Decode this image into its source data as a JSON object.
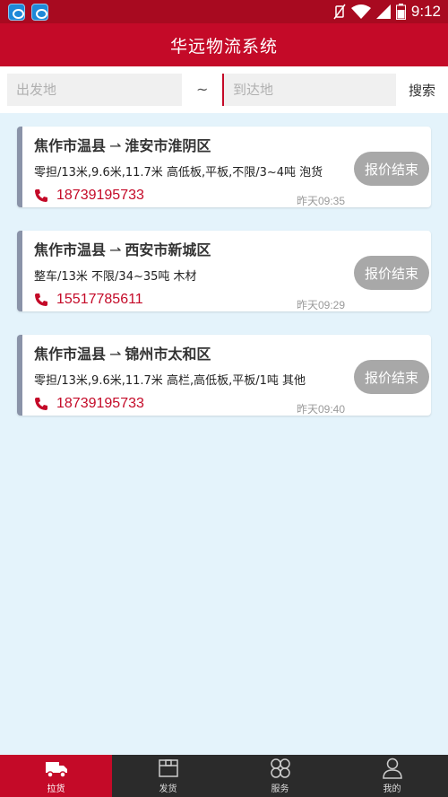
{
  "status_bar": {
    "time": "9:12"
  },
  "header": {
    "title": "华远物流系统"
  },
  "search": {
    "from_placeholder": "出发地",
    "separator": "~",
    "to_placeholder": "到达地",
    "button_label": "搜索"
  },
  "cargo_list": [
    {
      "from": "焦作市温县",
      "arrow": "⇀",
      "to": "淮安市淮阴区",
      "description": "零担/13米,9.6米,11.7米  高低板,平板,不限/3~4吨  泡货",
      "phone": "18739195733",
      "time": "昨天09:35",
      "status_button": "报价结束"
    },
    {
      "from": "焦作市温县",
      "arrow": "⇀",
      "to": "西安市新城区",
      "description": "整车/13米  不限/34~35吨  木材",
      "phone": "15517785611",
      "time": "昨天09:29",
      "status_button": "报价结束"
    },
    {
      "from": "焦作市温县",
      "arrow": "⇀",
      "to": "锦州市太和区",
      "description": "零担/13米,9.6米,11.7米  高栏,高低板,平板/1吨  其他",
      "phone": "18739195733",
      "time": "昨天09:40",
      "status_button": "报价结束"
    }
  ],
  "bottom_nav": [
    {
      "label": "拉货",
      "icon": "truck-icon",
      "active": true
    },
    {
      "label": "发货",
      "icon": "box-icon",
      "active": false
    },
    {
      "label": "服务",
      "icon": "clover-icon",
      "active": false
    },
    {
      "label": "我的",
      "icon": "person-icon",
      "active": false
    }
  ],
  "colors": {
    "brand_red": "#c40a28",
    "status_bar": "#a80a20",
    "background": "#e4f3fb",
    "card_accent": "#8a93a8",
    "button_gray": "#a8a8a8",
    "nav_bg": "#2b2b2b"
  }
}
